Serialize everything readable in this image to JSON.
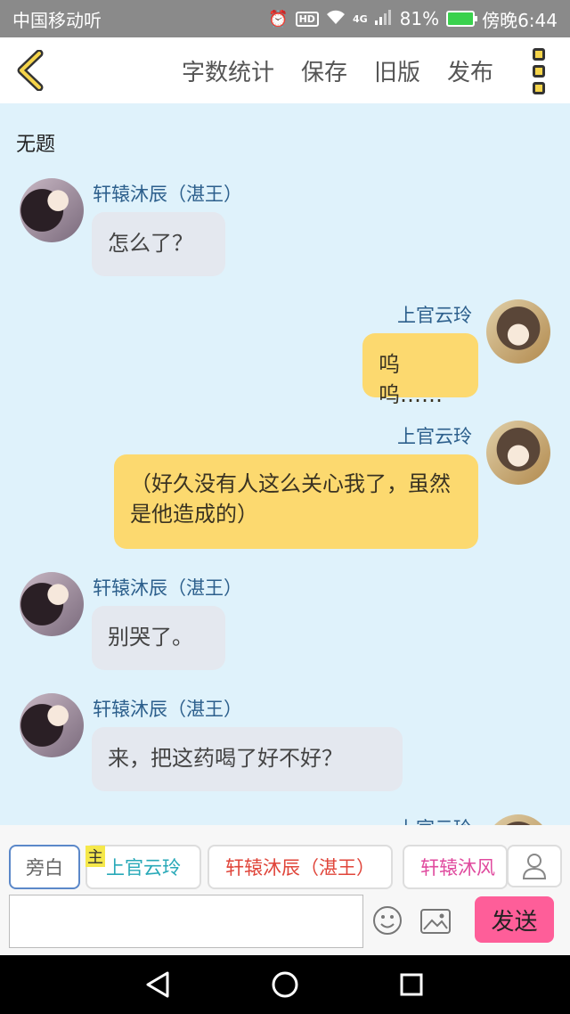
{
  "status_bar": {
    "carrier": "中国移动听",
    "network": "4G",
    "battery": "81%",
    "time": "傍晚6:44"
  },
  "header": {
    "menu": [
      "字数统计",
      "保存",
      "旧版",
      "发布"
    ]
  },
  "chat": {
    "title": "无题",
    "messages": [
      {
        "speaker": "轩辕沐辰（湛王）",
        "text": "怎么了？",
        "side": "left"
      },
      {
        "speaker": "上官云玲",
        "text": "呜呜……",
        "side": "right"
      },
      {
        "speaker": "上官云玲",
        "text": "（好久没有人这么关心我了，虽然是他造成的）",
        "side": "right"
      },
      {
        "speaker": "轩辕沐辰（湛王）",
        "text": "别哭了。",
        "side": "left"
      },
      {
        "speaker": "轩辕沐辰（湛王）",
        "text": "来，把这药喝了好不好？",
        "side": "left"
      },
      {
        "speaker": "上官云玲",
        "text": "",
        "side": "right"
      }
    ]
  },
  "selector": {
    "narration": "旁白",
    "main_badge": "主",
    "characters": [
      "上官云玲",
      "轩辕沐辰（湛王）",
      "轩辕沐风（"
    ]
  },
  "input": {
    "value": "",
    "placeholder": "",
    "send_label": "发送"
  },
  "colors": {
    "chat_bg": "#dff2fb",
    "bubble_left": "#e4e8ef",
    "bubble_right": "#fcd96f",
    "send_button": "#fe5e99",
    "name_color": "#2c5f8c"
  }
}
